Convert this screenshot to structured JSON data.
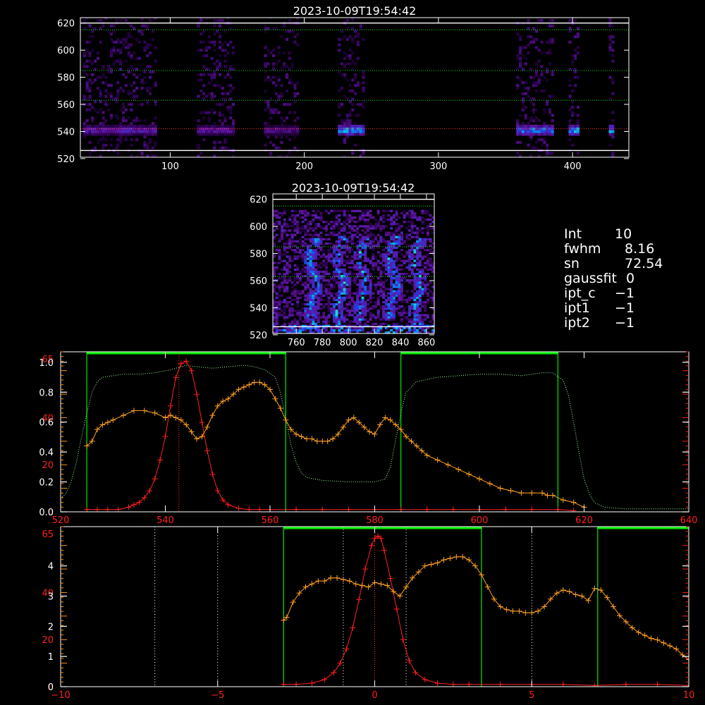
{
  "colors": {
    "background": "#000000",
    "axis": "#ffffff",
    "red_axis": "#ff2020",
    "orange_axis": "#ff9900",
    "red_profile": "#ff2020",
    "orange_profile": "#ffa020",
    "filter_curve": "#9cff9c",
    "window_line": "#00ee00",
    "center_line": "#ff3333",
    "guide_line": "#ffffff"
  },
  "info": {
    "rows": [
      {
        "key": "Int",
        "value": "10"
      },
      {
        "key": "fwhm",
        "value": "8.16"
      },
      {
        "key": "sn",
        "value": "72.54"
      },
      {
        "key": "gaussfit",
        "value": "0"
      },
      {
        "key": "ipt_c",
        "value": "−1"
      },
      {
        "key": "ipt1",
        "value": "−1"
      },
      {
        "key": "ipt2",
        "value": "−1"
      }
    ]
  },
  "chart_data": [
    {
      "type": "heatmap",
      "title": "2023-10-09T19:54:42",
      "xlim": [
        33,
        442
      ],
      "ylim": [
        521,
        624
      ],
      "xticks": [
        100,
        200,
        300,
        400
      ],
      "yticks": [
        520,
        540,
        560,
        580,
        600,
        620
      ],
      "hlines": [
        {
          "y": 615,
          "style": "dotted",
          "color": "green"
        },
        {
          "y": 585,
          "style": "dotted",
          "color": "green"
        },
        {
          "y": 563,
          "style": "dotted",
          "color": "green"
        },
        {
          "y": 542,
          "style": "dotted",
          "color": "red"
        },
        {
          "y": 526,
          "style": "solid",
          "color": "white"
        },
        {
          "y": 620,
          "style": "solid",
          "color": "white"
        }
      ],
      "bright_band": {
        "y_center": 541,
        "y_halfwidth": 3.5
      },
      "blocks": [
        {
          "x": [
            35,
            60
          ],
          "intensity": 0.55
        },
        {
          "x": [
            60,
            90
          ],
          "intensity": 0.6
        },
        {
          "x": [
            120,
            148
          ],
          "intensity": 0.5
        },
        {
          "x": [
            170,
            195
          ],
          "intensity": 0.45
        },
        {
          "x": [
            225,
            244
          ],
          "intensity": 1.0
        },
        {
          "x": [
            358,
            385
          ],
          "intensity": 0.95
        },
        {
          "x": [
            397,
            405
          ],
          "intensity": 1.0
        },
        {
          "x": [
            427,
            430
          ],
          "intensity": 1.0
        }
      ]
    },
    {
      "type": "heatmap",
      "title": "2023-10-09T19:54:42",
      "xlim": [
        742,
        866
      ],
      "ylim": [
        521,
        624
      ],
      "xticks": [
        760,
        780,
        800,
        820,
        840,
        860
      ],
      "yticks": [
        520,
        540,
        560,
        580,
        600,
        620
      ],
      "hlines": [
        {
          "y": 615,
          "style": "dotted",
          "color": "green"
        },
        {
          "y": 585,
          "style": "dotted",
          "color": "green"
        },
        {
          "y": 563,
          "style": "dotted",
          "color": "green"
        },
        {
          "y": 526,
          "style": "solid",
          "color": "white"
        },
        {
          "y": 620,
          "style": "solid",
          "color": "white"
        }
      ],
      "streaks": [
        {
          "x": 772,
          "y": [
            525,
            590
          ]
        },
        {
          "x": 793,
          "y": [
            525,
            592
          ]
        },
        {
          "x": 810,
          "y": [
            528,
            590
          ]
        },
        {
          "x": 833,
          "y": [
            530,
            592
          ]
        },
        {
          "x": 852,
          "y": [
            525,
            590
          ]
        }
      ]
    },
    {
      "type": "line",
      "xlim": [
        520,
        640
      ],
      "xticks": [
        520,
        540,
        560,
        580,
        600,
        620,
        640
      ],
      "left_axis_black": {
        "ylim": [
          0,
          1.07
        ],
        "ticks": [
          0.0,
          0.2,
          0.4,
          0.6,
          0.8,
          1.0
        ],
        "labels": [
          "0.0",
          "0.2",
          "0.4",
          "0.6",
          "0.8",
          "1.0"
        ]
      },
      "left_axis_red": {
        "ylim": [
          0,
          68
        ],
        "ticks": [
          0,
          20,
          40,
          65
        ],
        "labels": [
          "0",
          "20",
          "40",
          "65"
        ]
      },
      "windows": [
        {
          "x1": 525,
          "x2": 563
        },
        {
          "x1": 585,
          "x2": 615
        }
      ],
      "center_line_x": 542.6,
      "filter_curve": {
        "x": [
          520,
          521,
          522,
          523,
          524,
          525,
          526,
          527,
          528,
          530,
          532,
          535,
          538,
          541,
          543,
          544,
          546,
          549,
          552,
          555,
          557,
          559,
          561,
          562,
          563,
          564,
          565,
          566,
          567,
          570,
          575,
          580,
          582,
          583,
          584,
          585,
          586,
          588,
          592,
          596,
          600,
          604,
          608,
          612,
          614,
          616,
          617,
          618,
          619,
          620,
          621,
          622,
          624,
          628,
          632,
          636,
          640
        ],
        "y": [
          0.09,
          0.12,
          0.2,
          0.33,
          0.5,
          0.66,
          0.8,
          0.87,
          0.9,
          0.91,
          0.92,
          0.92,
          0.93,
          0.95,
          0.97,
          0.98,
          0.97,
          0.96,
          0.97,
          0.98,
          0.97,
          0.95,
          0.9,
          0.8,
          0.62,
          0.45,
          0.33,
          0.26,
          0.23,
          0.21,
          0.2,
          0.2,
          0.22,
          0.3,
          0.48,
          0.66,
          0.8,
          0.87,
          0.9,
          0.91,
          0.92,
          0.92,
          0.91,
          0.93,
          0.93,
          0.88,
          0.78,
          0.6,
          0.4,
          0.22,
          0.12,
          0.06,
          0.03,
          0.02,
          0.02,
          0.02,
          0.02
        ]
      },
      "series": [
        {
          "axis": "red",
          "color": "red",
          "x": [
            525,
            527,
            529,
            531,
            533,
            534,
            535,
            536,
            537,
            538,
            539,
            540,
            541,
            542,
            543,
            544,
            545,
            546,
            547,
            548,
            549,
            550,
            551,
            552,
            554,
            556,
            558,
            560,
            565,
            570,
            575,
            580,
            585,
            590,
            595,
            600,
            605,
            610,
            615,
            618
          ],
          "y": [
            1,
            1,
            1,
            1,
            2,
            3,
            4,
            6,
            9,
            14,
            22,
            32,
            45,
            57,
            63,
            64,
            60,
            50,
            38,
            26,
            16,
            9,
            5,
            3,
            1.5,
            1,
            1,
            1,
            1,
            1,
            1,
            1,
            1,
            1,
            1,
            1,
            1,
            1,
            1,
            0.5
          ]
        },
        {
          "axis": "red",
          "color": "orange",
          "x": [
            525,
            526,
            527,
            528,
            529,
            530,
            532,
            534,
            536,
            538,
            540,
            541,
            542,
            543,
            544,
            545,
            546,
            547,
            548,
            549,
            550,
            551,
            552,
            553,
            554,
            555,
            556,
            557,
            558,
            559,
            560,
            561,
            562,
            563,
            564,
            565,
            566,
            567,
            568,
            569,
            570,
            571,
            572,
            573,
            574,
            575,
            576,
            577,
            578,
            579,
            580,
            581,
            582,
            583,
            584,
            585,
            586,
            587,
            588,
            589,
            590,
            592,
            594,
            596,
            598,
            600,
            602,
            604,
            606,
            608,
            610,
            612,
            613,
            614,
            616,
            618,
            620
          ],
          "y": [
            28,
            30,
            35,
            37,
            38,
            39,
            41,
            43,
            43,
            42,
            40,
            41,
            40,
            39,
            37,
            34,
            31,
            32,
            36,
            41,
            45,
            47,
            48,
            50,
            52,
            53,
            54,
            55,
            55,
            54,
            52,
            48,
            44,
            39,
            35,
            33,
            32,
            31,
            31,
            30,
            30,
            30,
            31,
            33,
            36,
            39,
            40,
            38,
            36,
            34,
            33,
            37,
            40,
            39,
            37,
            35,
            32,
            30,
            28,
            26,
            24,
            22,
            20,
            18,
            16,
            14,
            12,
            10,
            9,
            8,
            8,
            8,
            7,
            7,
            5,
            4,
            2
          ]
        }
      ]
    },
    {
      "type": "line",
      "xlim": [
        -10,
        10
      ],
      "xticks": [
        -10,
        -5,
        0,
        5,
        10
      ],
      "left_axis_black": {
        "ylim": [
          0,
          5.3
        ],
        "ticks": [
          0,
          1,
          2,
          3,
          4
        ],
        "labels": [
          "0",
          "1",
          "2",
          "3",
          "4"
        ]
      },
      "left_axis_red": {
        "ylim": [
          0,
          68
        ],
        "ticks": [
          0,
          20,
          40,
          65
        ],
        "labels": [
          "0",
          "20",
          "40",
          "65"
        ]
      },
      "windows": [
        {
          "x1": -2.9,
          "x2": 3.4
        },
        {
          "x1": 7.1,
          "x2": 10
        }
      ],
      "guide_lines_x": [
        -7,
        -5,
        -1,
        1,
        5
      ],
      "center_line_x": 0,
      "series": [
        {
          "axis": "red",
          "color": "red",
          "x": [
            -2.9,
            -2.5,
            -2.0,
            -1.6,
            -1.3,
            -1.1,
            -0.9,
            -0.7,
            -0.5,
            -0.3,
            -0.1,
            0.0,
            0.1,
            0.2,
            0.3,
            0.5,
            0.7,
            0.9,
            1.1,
            1.3,
            1.6,
            2.0,
            2.5,
            3.0,
            4.0,
            5.0,
            6.0,
            7.0,
            8.0,
            9.0,
            10.0
          ],
          "y": [
            1,
            1,
            1.5,
            3,
            6,
            10,
            16,
            25,
            37,
            50,
            60,
            63,
            64,
            63,
            58,
            46,
            33,
            20,
            11,
            6,
            3,
            1.5,
            1,
            1,
            1,
            1,
            1,
            0.5,
            1,
            1,
            0.5
          ]
        },
        {
          "axis": "black",
          "color": "orange",
          "x": [
            -2.9,
            -2.8,
            -2.6,
            -2.4,
            -2.2,
            -2.0,
            -1.8,
            -1.6,
            -1.4,
            -1.2,
            -1.0,
            -0.8,
            -0.6,
            -0.4,
            -0.2,
            0.0,
            0.2,
            0.4,
            0.6,
            0.8,
            1.0,
            1.2,
            1.4,
            1.6,
            1.8,
            2.0,
            2.2,
            2.4,
            2.6,
            2.8,
            3.0,
            3.2,
            3.4,
            3.6,
            3.8,
            4.0,
            4.2,
            4.4,
            4.6,
            4.8,
            5.0,
            5.2,
            5.4,
            5.6,
            5.8,
            6.0,
            6.2,
            6.4,
            6.6,
            6.8,
            7.0,
            7.2,
            7.4,
            7.6,
            7.8,
            8.0,
            8.2,
            8.4,
            8.6,
            8.8,
            9.0,
            9.2,
            9.4,
            9.6,
            9.8,
            10.0
          ],
          "y": [
            2.2,
            2.3,
            2.8,
            3.1,
            3.3,
            3.4,
            3.5,
            3.5,
            3.6,
            3.6,
            3.55,
            3.5,
            3.4,
            3.35,
            3.3,
            3.45,
            3.4,
            3.35,
            3.15,
            3.0,
            3.3,
            3.6,
            3.8,
            4.0,
            4.05,
            4.1,
            4.2,
            4.25,
            4.3,
            4.3,
            4.2,
            4.0,
            3.7,
            3.3,
            2.9,
            2.65,
            2.55,
            2.5,
            2.5,
            2.45,
            2.45,
            2.5,
            2.65,
            2.9,
            3.1,
            3.2,
            3.15,
            3.05,
            3.0,
            2.85,
            3.25,
            3.2,
            2.95,
            2.65,
            2.35,
            2.15,
            1.95,
            1.8,
            1.7,
            1.6,
            1.55,
            1.45,
            1.35,
            1.25,
            1.05,
            0.9
          ]
        }
      ]
    }
  ]
}
